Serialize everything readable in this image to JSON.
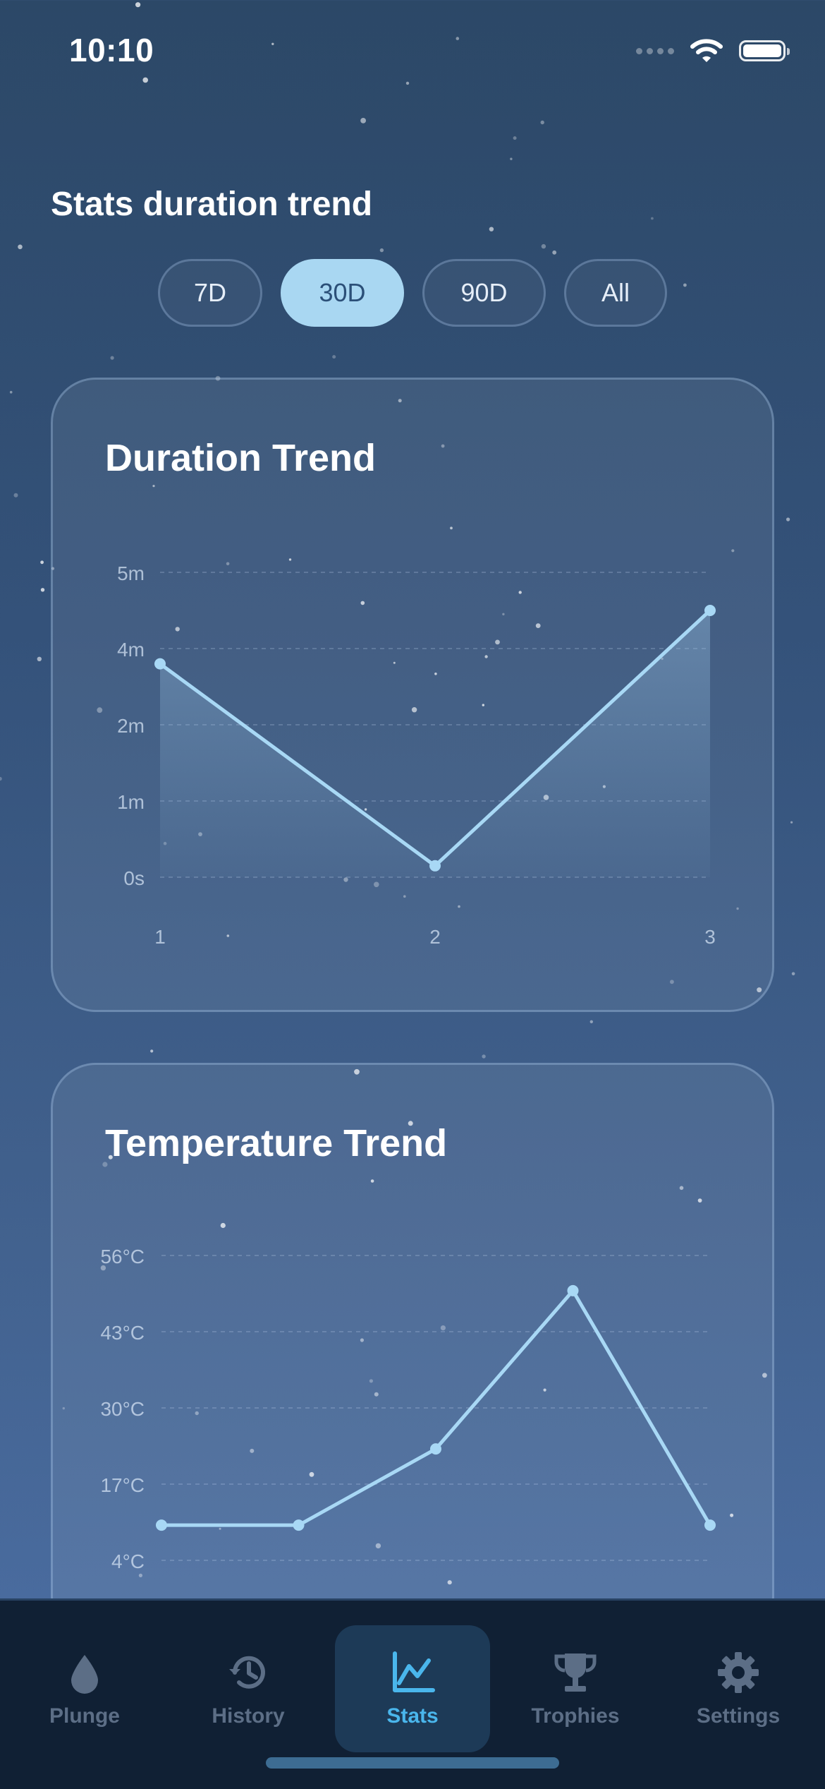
{
  "status_bar": {
    "time": "10:10",
    "icons": [
      "cellular-signal-icon",
      "wifi-icon",
      "battery-icon"
    ]
  },
  "page": {
    "title": "Stats duration trend"
  },
  "range_tabs": [
    {
      "label": "7D",
      "active": false
    },
    {
      "label": "30D",
      "active": true
    },
    {
      "label": "90D",
      "active": false
    },
    {
      "label": "All",
      "active": false
    }
  ],
  "duration_card": {
    "title": "Duration Trend"
  },
  "temperature_card": {
    "title": "Temperature Trend"
  },
  "chart_data": [
    {
      "type": "area",
      "title": "Duration Trend",
      "x": [
        1,
        2,
        3
      ],
      "x_tick_labels": [
        "1",
        "2",
        "3"
      ],
      "y_tick_labels": [
        "0s",
        "1m",
        "2m",
        "4m",
        "5m"
      ],
      "y_tick_values": [
        0,
        1,
        2,
        4,
        5
      ],
      "values": [
        3.6,
        0.15,
        4.5
      ],
      "grid": true,
      "colors": {
        "line": "#a8d8f5",
        "fill": "#9cc6e8"
      }
    },
    {
      "type": "line",
      "title": "Temperature Trend",
      "x": [
        1,
        2,
        3,
        4,
        5
      ],
      "y_tick_labels": [
        "4°C",
        "17°C",
        "30°C",
        "43°C",
        "56°C"
      ],
      "y_tick_values": [
        4,
        17,
        30,
        43,
        56
      ],
      "values": [
        10,
        10,
        23,
        50,
        10
      ],
      "grid": true,
      "colors": {
        "line": "#a8d8f5"
      }
    }
  ],
  "bottom_nav": [
    {
      "label": "Plunge",
      "icon": "water-drop-icon",
      "active": false
    },
    {
      "label": "History",
      "icon": "history-clock-icon",
      "active": false
    },
    {
      "label": "Stats",
      "icon": "chart-line-icon",
      "active": true
    },
    {
      "label": "Trophies",
      "icon": "trophy-icon",
      "active": false
    },
    {
      "label": "Settings",
      "icon": "gear-icon",
      "active": false
    }
  ],
  "colors": {
    "accent": "#4ab6ec",
    "active_tab_bg": "#a9d7f2",
    "nav_bg": "#102034",
    "chart_line": "#a8d8f5"
  }
}
